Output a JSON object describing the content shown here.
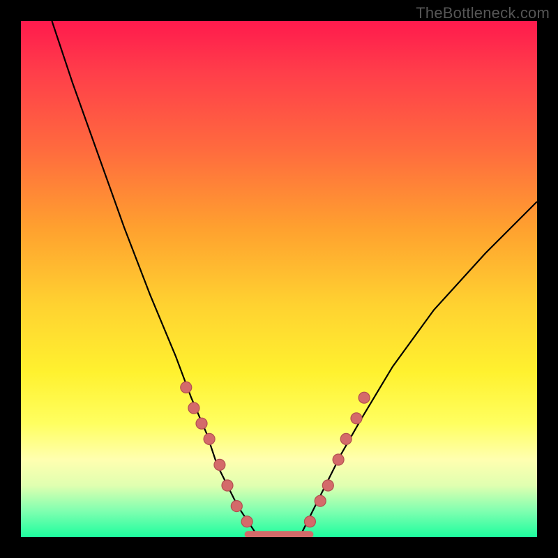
{
  "watermark": "TheBottleneck.com",
  "chart_data": {
    "type": "line",
    "title": "",
    "xlabel": "",
    "ylabel": "",
    "ylim": [
      0,
      100
    ],
    "xlim": [
      0,
      100
    ],
    "series": [
      {
        "name": "left-curve",
        "x": [
          6,
          10,
          15,
          20,
          25,
          30,
          33,
          36,
          38,
          40,
          42,
          44,
          46
        ],
        "y": [
          100,
          88,
          74,
          60,
          47,
          35,
          27,
          20,
          14,
          10,
          6,
          3,
          0
        ]
      },
      {
        "name": "right-curve",
        "x": [
          54,
          56,
          58,
          60,
          62,
          66,
          72,
          80,
          90,
          100
        ],
        "y": [
          0,
          4,
          8,
          12,
          16,
          23,
          33,
          44,
          55,
          65
        ]
      }
    ],
    "markers": {
      "name": "highlight-dots",
      "points": [
        {
          "x": 32.0,
          "y": 29
        },
        {
          "x": 33.5,
          "y": 25
        },
        {
          "x": 35.0,
          "y": 22
        },
        {
          "x": 36.5,
          "y": 19
        },
        {
          "x": 38.5,
          "y": 14
        },
        {
          "x": 40.0,
          "y": 10
        },
        {
          "x": 41.8,
          "y": 6
        },
        {
          "x": 43.8,
          "y": 3
        },
        {
          "x": 56.0,
          "y": 3
        },
        {
          "x": 58.0,
          "y": 7
        },
        {
          "x": 59.5,
          "y": 10
        },
        {
          "x": 61.5,
          "y": 15
        },
        {
          "x": 63.0,
          "y": 19
        },
        {
          "x": 65.0,
          "y": 23
        },
        {
          "x": 66.5,
          "y": 27
        }
      ]
    },
    "floor_segment": {
      "x0": 44,
      "x1": 56,
      "y": 0.5
    }
  }
}
